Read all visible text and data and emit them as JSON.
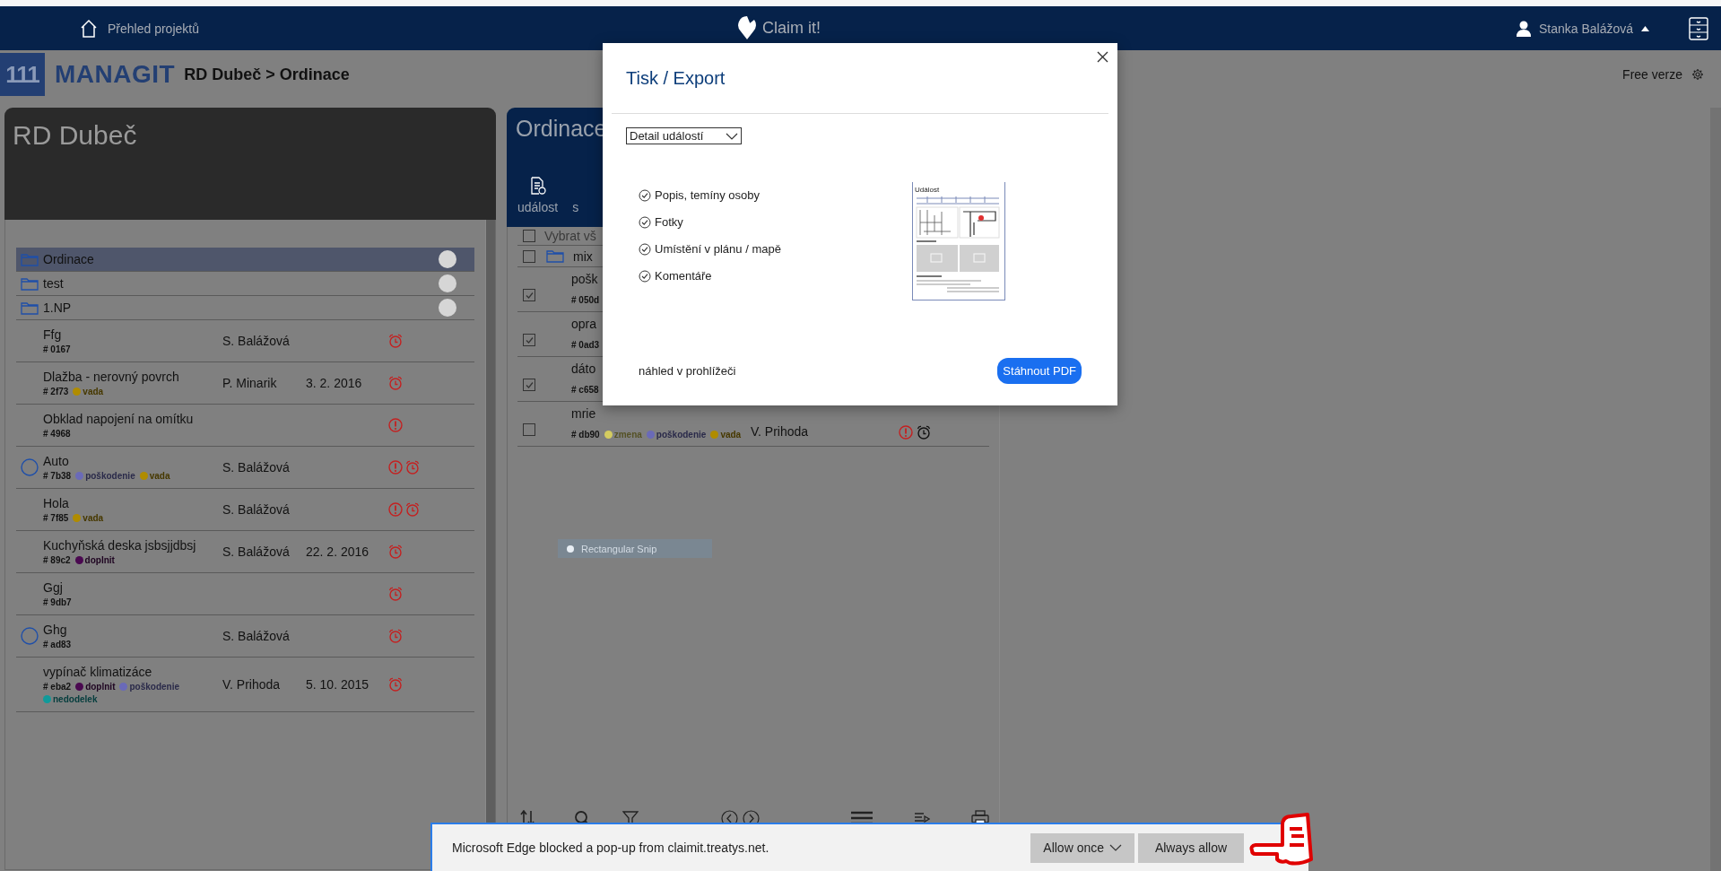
{
  "top_nav": {
    "home_link": "Přehled projektů",
    "app_name": "Claim it!",
    "user": "Stanka Balážová"
  },
  "header": {
    "logo_mark": "111",
    "logo_text": "MANAGIT",
    "breadcrumb": "RD Dubeč > Ordinace",
    "plan": "Free verze"
  },
  "left_panel": {
    "title": "RD Dubeč",
    "items": [
      {
        "kind": "folder",
        "name": "Ordinace",
        "selected": true
      },
      {
        "kind": "folder",
        "name": "test",
        "selected": false
      },
      {
        "kind": "folder",
        "name": "1.NP",
        "selected": false
      },
      {
        "kind": "event",
        "title": "Ffg",
        "code": "# 0167",
        "person": "S. Balážová",
        "marked": false,
        "alerts": [
          {
            "kind": "alarm",
            "color": "#c42020"
          }
        ]
      },
      {
        "kind": "event",
        "title": "Dlažba - nerovný povrch",
        "code": "# 2f73",
        "tags": [
          {
            "label": "vada",
            "color": "#b08c00"
          }
        ],
        "person": "P. Minarik",
        "date": "3. 2. 2016",
        "marked": false,
        "alerts": [
          {
            "kind": "alarm",
            "color": "#c42020"
          }
        ]
      },
      {
        "kind": "event",
        "title": "Obklad napojení na omítku",
        "code": "# 4968",
        "marked": false,
        "alerts": [
          {
            "kind": "warning",
            "color": "#c42020"
          }
        ]
      },
      {
        "kind": "event",
        "title": "Auto",
        "code": "# 7b38",
        "tags": [
          {
            "label": "poškodenie",
            "color": "#6a6ab8"
          },
          {
            "label": "vada",
            "color": "#b08c00"
          }
        ],
        "person": "S. Balážová",
        "marked": true,
        "alerts": [
          {
            "kind": "warning",
            "color": "#c42020"
          },
          {
            "kind": "alarm",
            "color": "#c42020"
          }
        ]
      },
      {
        "kind": "event",
        "title": "Hola",
        "code": "# 7f85",
        "tags": [
          {
            "label": "vada",
            "color": "#b08c00"
          }
        ],
        "person": "S. Balážová",
        "marked": false,
        "alerts": [
          {
            "kind": "warning",
            "color": "#c42020"
          },
          {
            "kind": "alarm",
            "color": "#c42020"
          }
        ]
      },
      {
        "kind": "event",
        "title": "Kuchyňská deska jsbsjjdbsj",
        "code": "# 89c2",
        "tags": [
          {
            "label": "doplnit",
            "color": "#4a0850"
          }
        ],
        "person": "S. Balážová",
        "date": "22. 2. 2016",
        "marked": false,
        "alerts": [
          {
            "kind": "alarm",
            "color": "#c42020"
          }
        ]
      },
      {
        "kind": "event",
        "title": "Ggj",
        "code": "# 9db7",
        "marked": false,
        "alerts": [
          {
            "kind": "alarm",
            "color": "#c42020"
          }
        ]
      },
      {
        "kind": "event",
        "title": "Ghg",
        "code": "# ad83",
        "person": "S. Balážová",
        "marked": true,
        "alerts": [
          {
            "kind": "alarm",
            "color": "#c42020"
          }
        ]
      },
      {
        "kind": "event",
        "title": "vypínač klimatizáce",
        "code": "# eba2",
        "tags": [
          {
            "label": "doplnit",
            "color": "#4a0850"
          },
          {
            "label": "poškodenie",
            "color": "#6a6ab8"
          },
          {
            "label": "nedodelek",
            "color": "#109a9a"
          }
        ],
        "person": "V. Prihoda",
        "date": "5. 10. 2015",
        "marked": false,
        "alerts": [
          {
            "kind": "alarm",
            "color": "#c42020"
          }
        ]
      }
    ]
  },
  "middle_panel": {
    "title": "Ordinace",
    "toolbar": [
      {
        "label": "událost",
        "kind": "new"
      },
      {
        "label": "s",
        "kind": "plain"
      }
    ],
    "select_all": {
      "label": "Vybrat vš",
      "checked": false
    },
    "items": [
      {
        "kind": "folder",
        "name": "mix",
        "checked": false
      },
      {
        "kind": "event",
        "title": "pošk",
        "code": "# 050d",
        "checked": true
      },
      {
        "kind": "event",
        "title": "opra",
        "code": "# 0ad3",
        "checked": true
      },
      {
        "kind": "event",
        "title": "dáto",
        "code": "# c658",
        "checked": true
      },
      {
        "kind": "event",
        "title": "mrie",
        "code": "# db90",
        "tags": [
          {
            "label": "zmena",
            "color": "#d4cc60"
          },
          {
            "label": "poškodenie",
            "color": "#6a6ab8"
          },
          {
            "label": "vada",
            "color": "#b08c00"
          }
        ],
        "person": "V. Prihoda",
        "checked": false,
        "alerts": [
          {
            "kind": "warning",
            "color": "#c42020"
          },
          {
            "kind": "alarm",
            "color": "#111111"
          }
        ]
      }
    ]
  },
  "tooltip": {
    "label": "Rectangular Snip"
  },
  "modal": {
    "title": "Tisk / Export",
    "template": "Detail událostí",
    "sections": [
      {
        "label": "Popis, temíny osoby",
        "checked": true
      },
      {
        "label": "Fotky",
        "checked": true
      },
      {
        "label": "Umístění v plánu / mapě",
        "checked": true
      },
      {
        "label": "Komentáře",
        "checked": true
      }
    ],
    "preview_heading": "Událost",
    "preview_link": "náhled v prohlížeči",
    "download_button": "Stáhnout PDF"
  },
  "notification_bar": {
    "message": "Microsoft Edge blocked a pop-up from claimit.treatys.net.",
    "buttons": [
      {
        "label": "Allow once",
        "kind": "dropdown"
      },
      {
        "label": "Always allow",
        "kind": "plain"
      }
    ]
  }
}
